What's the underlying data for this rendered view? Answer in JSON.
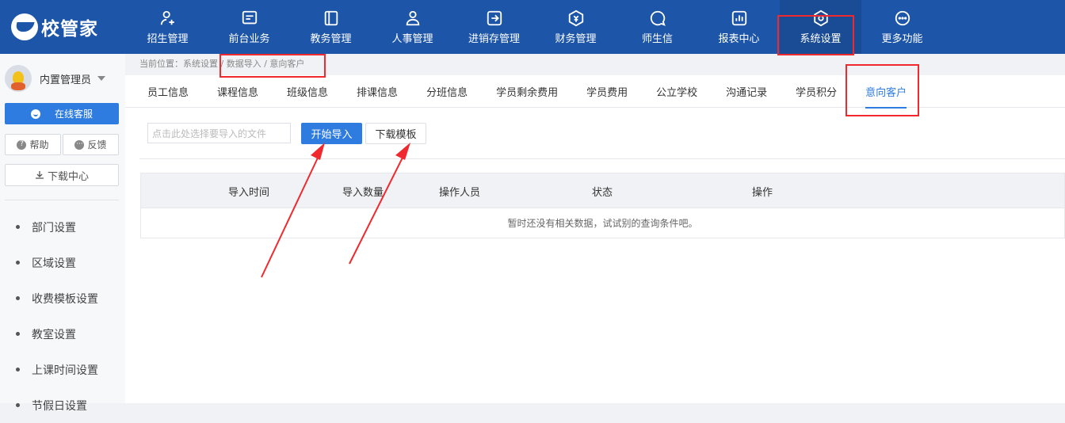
{
  "app": {
    "logo_text": "校管家"
  },
  "nav": [
    {
      "label": "招生管理",
      "icon": "user-add-icon"
    },
    {
      "label": "前台业务",
      "icon": "monitor-icon"
    },
    {
      "label": "教务管理",
      "icon": "book-icon"
    },
    {
      "label": "人事管理",
      "icon": "person-icon"
    },
    {
      "label": "进销存管理",
      "icon": "box-arrow-icon"
    },
    {
      "label": "财务管理",
      "icon": "money-icon"
    },
    {
      "label": "师生信",
      "icon": "chat-icon"
    },
    {
      "label": "报表中心",
      "icon": "chart-icon"
    },
    {
      "label": "系统设置",
      "icon": "settings-icon"
    },
    {
      "label": "更多功能",
      "icon": "more-icon"
    }
  ],
  "sidebar": {
    "user_name": "内置管理员",
    "service_button": "在线客服",
    "help": "帮助",
    "feedback": "反馈",
    "download_center": "下载中心",
    "menu": [
      "部门设置",
      "区域设置",
      "收费模板设置",
      "教室设置",
      "上课时间设置",
      "节假日设置"
    ]
  },
  "breadcrumb": "当前位置：系统设置 / 数据导入 / 意向客户",
  "tabs": [
    "员工信息",
    "课程信息",
    "班级信息",
    "排课信息",
    "分班信息",
    "学员剩余费用",
    "学员费用",
    "公立学校",
    "沟通记录",
    "学员积分",
    "意向客户"
  ],
  "import": {
    "file_placeholder": "点击此处选择要导入的文件",
    "start_button": "开始导入",
    "template_button": "下载模板"
  },
  "table": {
    "headers": [
      "导入时间",
      "导入数量",
      "操作人员",
      "状态",
      "操作"
    ],
    "empty_text": "暂时还没有相关数据，试试别的查询条件吧。"
  },
  "colors": {
    "topbar": "#1d56a8",
    "accent": "#2f7ce0",
    "annotation": "#f0292e"
  }
}
